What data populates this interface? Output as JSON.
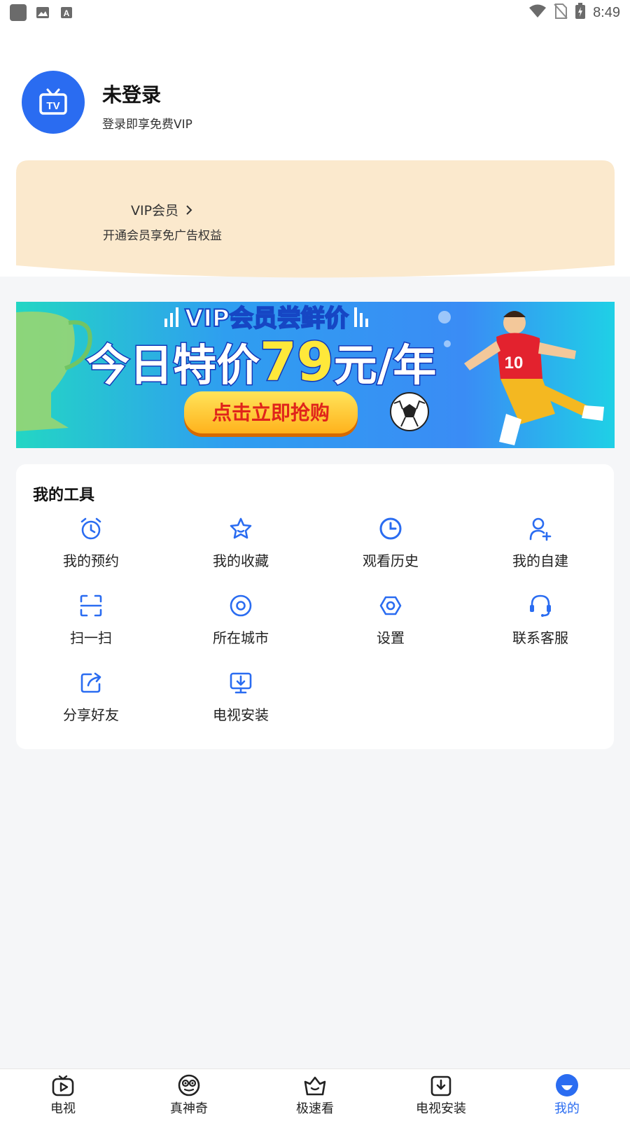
{
  "status_bar": {
    "time": "8:49"
  },
  "profile": {
    "name": "未登录",
    "subtitle": "登录即享免费VIP",
    "avatar_icon": "tv-icon"
  },
  "vip_card": {
    "title": "VIP会员",
    "subtitle": "开通会员享免广告权益",
    "bg_color": "#fbe9cd"
  },
  "banner": {
    "headline": "VIP会员尝鲜价",
    "price_line_prefix": "今日特价",
    "price": "79",
    "price_line_suffix": "元/年",
    "button": "点击立即抢购",
    "jersey_number": "10"
  },
  "tools": {
    "title": "我的工具",
    "items": [
      {
        "label": "我的预约",
        "icon": "alarm-clock-icon"
      },
      {
        "label": "我的收藏",
        "icon": "star-icon"
      },
      {
        "label": "观看历史",
        "icon": "clock-icon"
      },
      {
        "label": "我的自建",
        "icon": "add-user-icon"
      },
      {
        "label": "扫一扫",
        "icon": "scan-icon"
      },
      {
        "label": "所在城市",
        "icon": "location-pin-icon"
      },
      {
        "label": "设置",
        "icon": "settings-hex-icon"
      },
      {
        "label": "联系客服",
        "icon": "headset-icon"
      },
      {
        "label": "分享好友",
        "icon": "share-icon"
      },
      {
        "label": "电视安装",
        "icon": "tv-download-icon"
      }
    ]
  },
  "bottom_nav": {
    "items": [
      {
        "label": "电视",
        "icon": "play-tv-icon"
      },
      {
        "label": "真神奇",
        "icon": "eyes-icon"
      },
      {
        "label": "极速看",
        "icon": "crown-basket-icon"
      },
      {
        "label": "电视安装",
        "icon": "download-box-icon"
      },
      {
        "label": "我的",
        "icon": "profile-icon",
        "active": true
      }
    ]
  },
  "colors": {
    "accent": "#2a6cf1",
    "page_bg": "#f5f6f8"
  }
}
